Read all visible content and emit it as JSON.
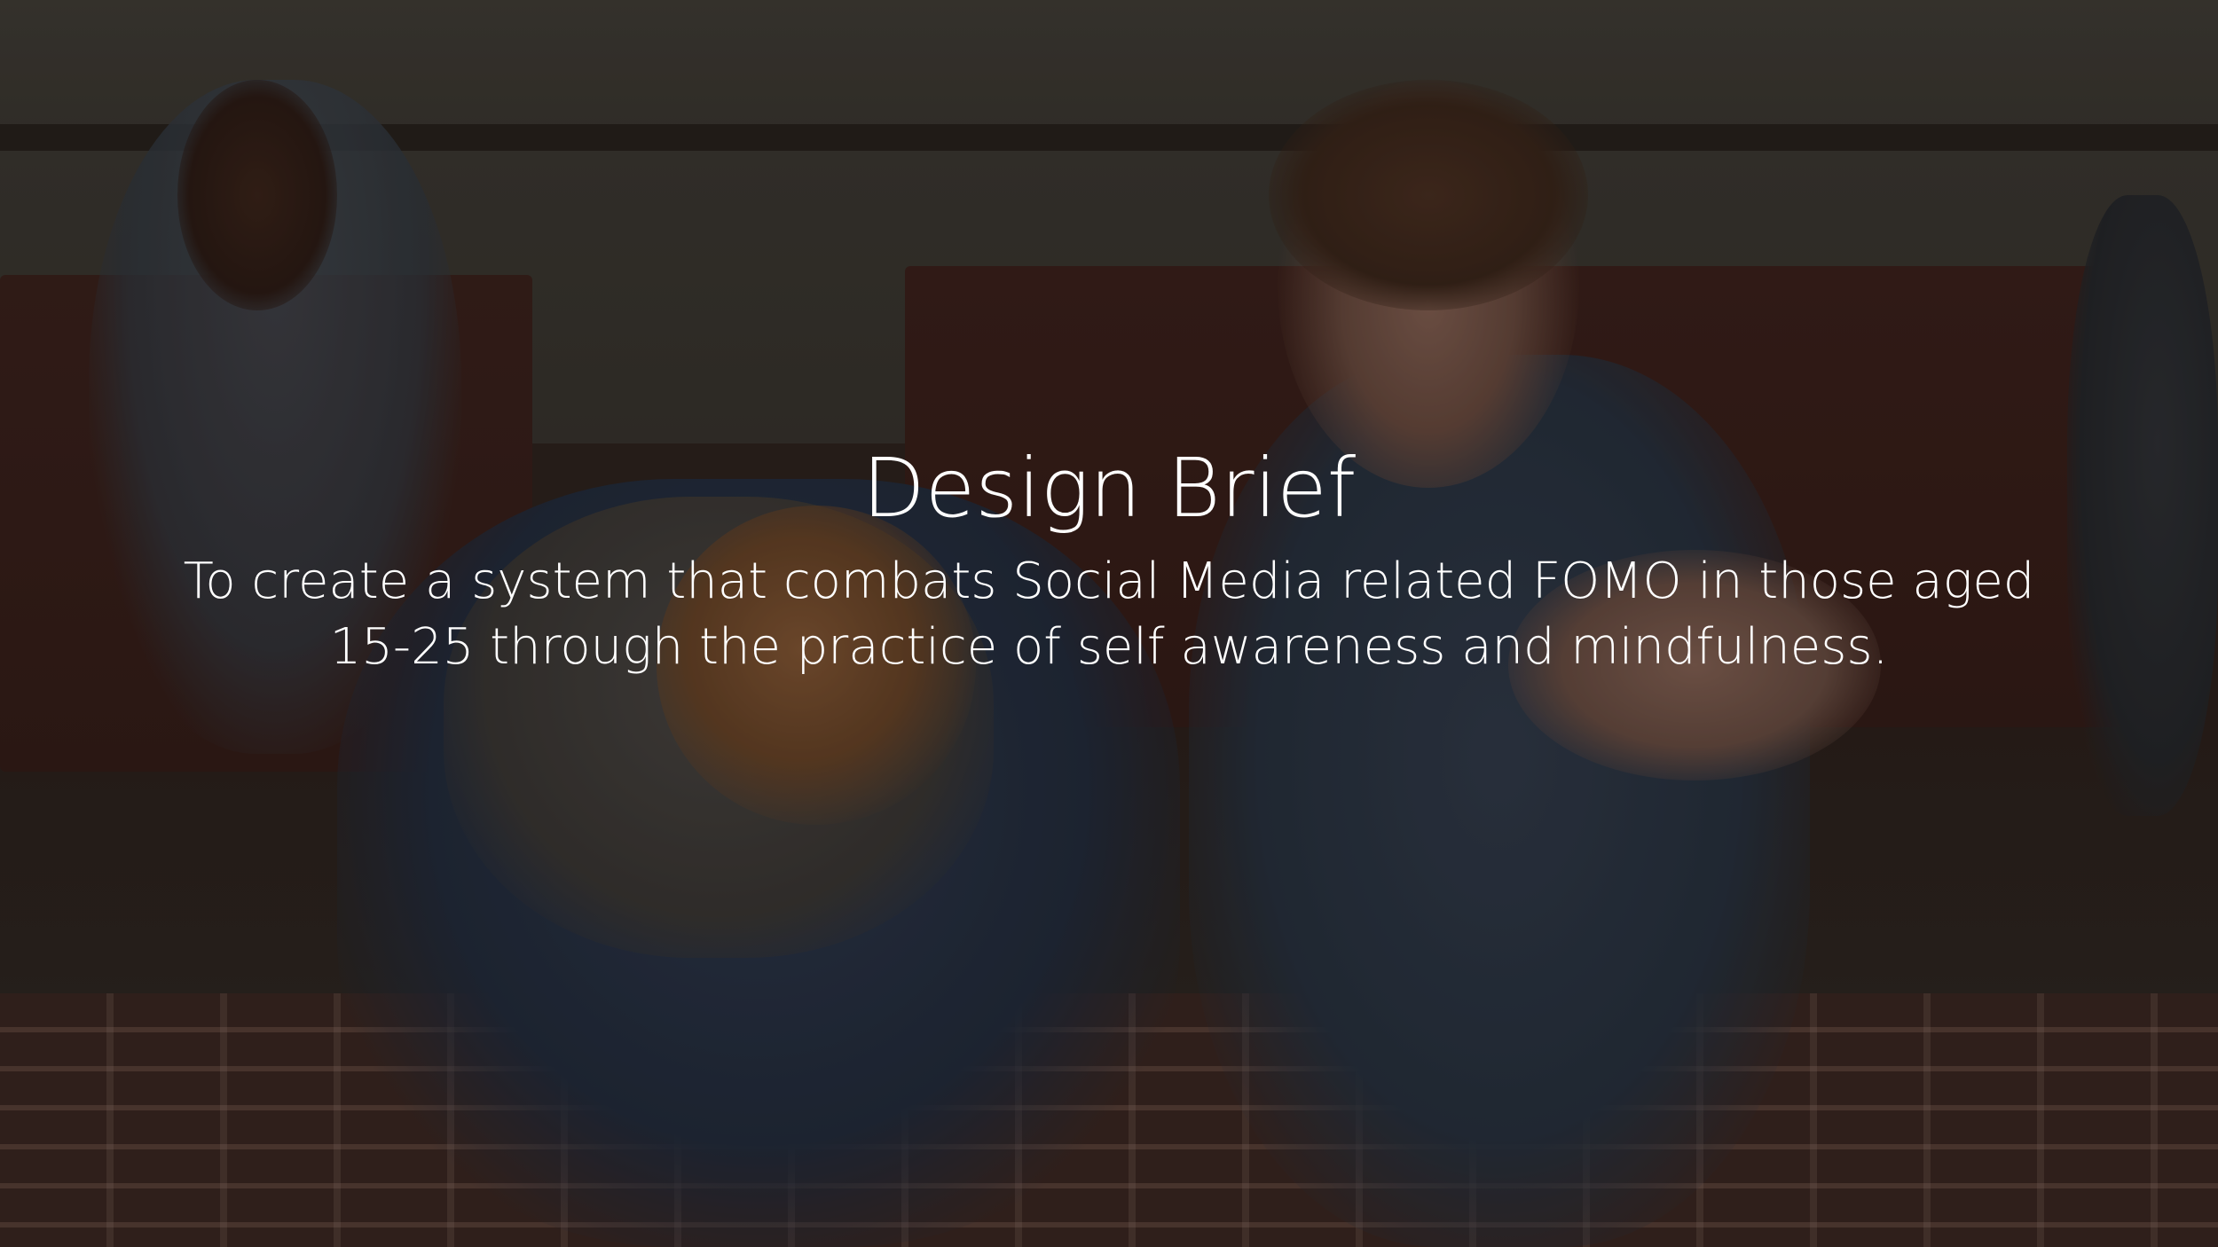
{
  "slide": {
    "title": "Design Brief",
    "body_line_1": "To create a system that combats Social Media related FOMO in those aged",
    "body_line_2": "15-25 through the practice of self awareness and mindfulness."
  },
  "colors": {
    "text": "#ffffff",
    "overlay": "rgba(20, 18, 16, 0.28)"
  }
}
